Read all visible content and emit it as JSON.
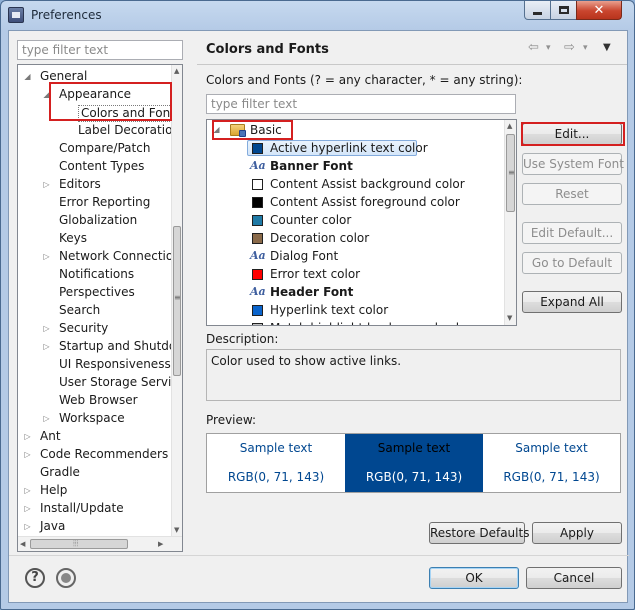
{
  "window": {
    "title": "Preferences"
  },
  "left": {
    "filter_placeholder": "type filter text",
    "tree": [
      {
        "label": "General",
        "expander": "◢"
      },
      {
        "label": "Appearance",
        "expander": "◢"
      },
      {
        "label": "Colors and Fonts",
        "expander": ""
      },
      {
        "label": "Label Decorations",
        "expander": ""
      },
      {
        "label": "Compare/Patch",
        "expander": ""
      },
      {
        "label": "Content Types",
        "expander": ""
      },
      {
        "label": "Editors",
        "expander": "▷"
      },
      {
        "label": "Error Reporting",
        "expander": ""
      },
      {
        "label": "Globalization",
        "expander": ""
      },
      {
        "label": "Keys",
        "expander": ""
      },
      {
        "label": "Network Connections",
        "expander": "▷"
      },
      {
        "label": "Notifications",
        "expander": ""
      },
      {
        "label": "Perspectives",
        "expander": ""
      },
      {
        "label": "Search",
        "expander": ""
      },
      {
        "label": "Security",
        "expander": "▷"
      },
      {
        "label": "Startup and Shutdown",
        "expander": "▷"
      },
      {
        "label": "UI Responsiveness Monitoring",
        "expander": ""
      },
      {
        "label": "User Storage Service",
        "expander": ""
      },
      {
        "label": "Web Browser",
        "expander": ""
      },
      {
        "label": "Workspace",
        "expander": "▷"
      },
      {
        "label": "Ant",
        "expander": "▷"
      },
      {
        "label": "Code Recommenders",
        "expander": "▷"
      },
      {
        "label": "Gradle",
        "expander": ""
      },
      {
        "label": "Help",
        "expander": "▷"
      },
      {
        "label": "Install/Update",
        "expander": "▷"
      },
      {
        "label": "Java",
        "expander": "▷"
      }
    ]
  },
  "page": {
    "title": "Colors and Fonts",
    "nav": {
      "back": "⇦",
      "back_menu": "▾",
      "forward": "⇨",
      "forward_menu": "▾",
      "view_menu": "▼"
    },
    "filter_label": "Colors and Fonts (? = any character, * = any string):",
    "filter_placeholder": "type filter text",
    "category": {
      "label": "Basic",
      "expander": "◢"
    },
    "items": [
      {
        "label": "Active hyperlink text color",
        "kind": "color",
        "color": "#004790"
      },
      {
        "label": "Banner Font",
        "kind": "font",
        "icon": "Aa",
        "bold": true
      },
      {
        "label": "Content Assist background color",
        "kind": "color",
        "color": "#ffffff"
      },
      {
        "label": "Content Assist foreground color",
        "kind": "color",
        "color": "#000000"
      },
      {
        "label": "Counter color",
        "kind": "color",
        "color": "#1f7aa6"
      },
      {
        "label": "Decoration color",
        "kind": "color",
        "color": "#8a6a4a"
      },
      {
        "label": "Dialog Font",
        "kind": "font",
        "icon": "Aa",
        "bold": false
      },
      {
        "label": "Error text color",
        "kind": "color",
        "color": "#ff0000"
      },
      {
        "label": "Header Font",
        "kind": "font",
        "icon": "Aa",
        "bold": true
      },
      {
        "label": "Hyperlink text color",
        "kind": "color",
        "color": "#0a64cc"
      },
      {
        "label": "Match highlight background color",
        "kind": "color",
        "color": "#c0c0c0"
      }
    ],
    "buttons": {
      "edit": "Edit...",
      "use_system_font": "Use System Font",
      "reset": "Reset",
      "edit_default": "Edit Default...",
      "go_to_default": "Go to Default",
      "expand_all": "Expand All"
    },
    "description_label": "Description:",
    "description": "Color used to show active links.",
    "preview_label": "Preview:",
    "preview": {
      "sample_text": "Sample text",
      "rgb_text": "RGB(0, 71, 143)",
      "accent": "#004790"
    },
    "restore_defaults": "Restore Defaults",
    "apply": "Apply"
  },
  "footer": {
    "help_symbol": "?",
    "ok": "OK",
    "cancel": "Cancel"
  }
}
